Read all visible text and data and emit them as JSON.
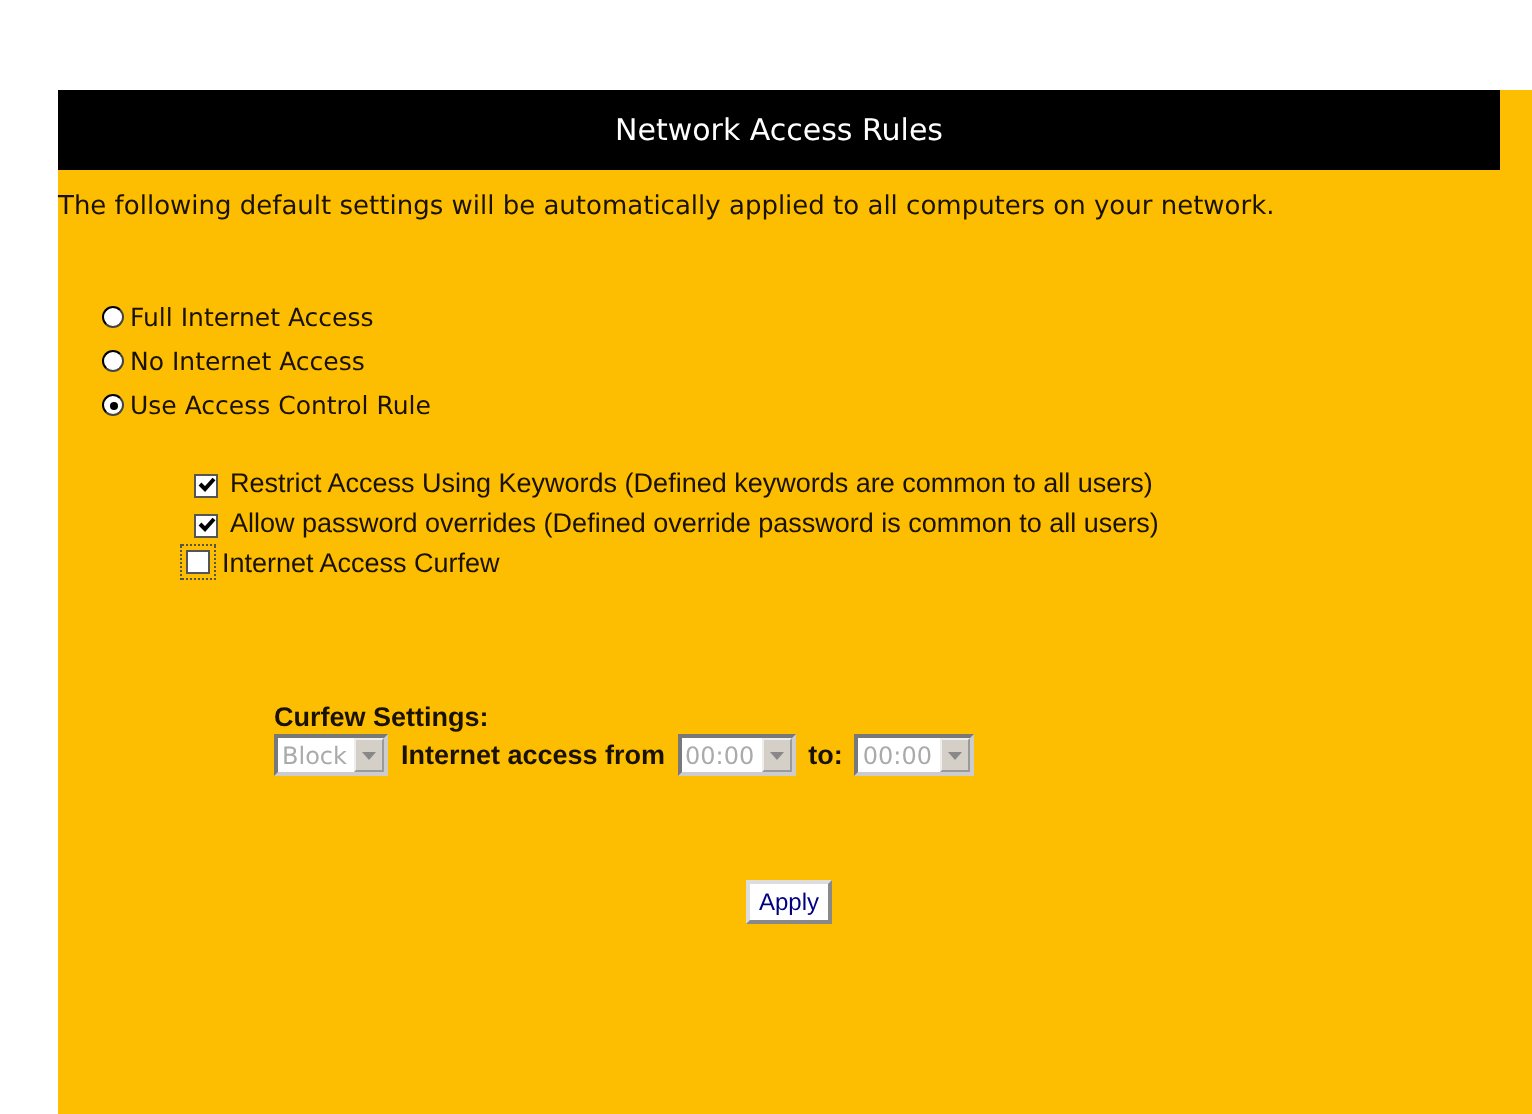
{
  "header": {
    "title": "Network Access Rules"
  },
  "intro": "The following default settings will be automatically applied to all computers on your network.",
  "access_options": [
    {
      "label": "Full Internet Access",
      "selected": false
    },
    {
      "label": "No Internet Access",
      "selected": false
    },
    {
      "label": "Use Access Control Rule",
      "selected": true
    }
  ],
  "rules": [
    {
      "label": "Restrict Access Using Keywords (Defined keywords are common to all users)",
      "checked": true
    },
    {
      "label": "Allow password overrides (Defined override password is common to all users)",
      "checked": true
    },
    {
      "label": "Internet Access Curfew",
      "checked": false
    }
  ],
  "curfew": {
    "heading": "Curfew Settings:",
    "action": {
      "value": "Block",
      "disabled": true
    },
    "from_label": "Internet access from",
    "from": {
      "value": "00:00",
      "disabled": true
    },
    "to_label": "to:",
    "to": {
      "value": "00:00",
      "disabled": true
    }
  },
  "buttons": [
    {
      "label": "Apply"
    }
  ]
}
